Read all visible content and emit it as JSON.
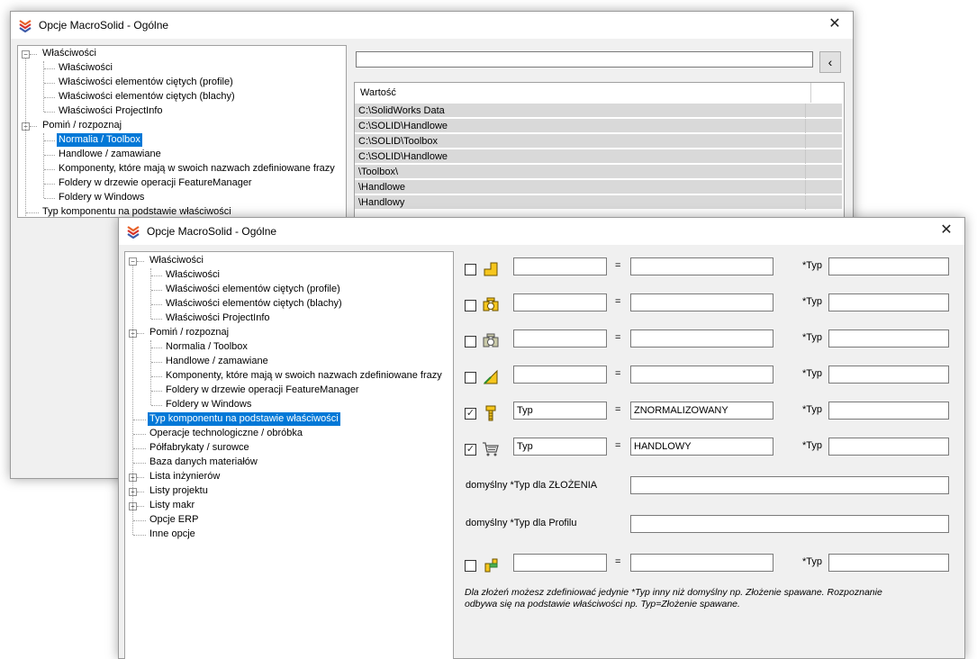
{
  "back_window": {
    "title": "Opcje MacroSolid - Ogólne",
    "close_label": "✕",
    "tree": [
      {
        "label": "Właściwości",
        "expander": "−"
      },
      {
        "label": "Właściwości"
      },
      {
        "label": "Właściwości elementów ciętych (profile)"
      },
      {
        "label": "Właściwości elementów ciętych (blachy)"
      },
      {
        "label": "Właściwości ProjectInfo"
      },
      {
        "label": "Pomiń / rozpoznaj",
        "expander": "−"
      },
      {
        "label": "Normalia / Toolbox"
      },
      {
        "label": "Handlowe / zamawiane"
      },
      {
        "label": "Komponenty, które mają w swoich nazwach zdefiniowane frazy"
      },
      {
        "label": "Foldery w drzewie operacji FeatureManager"
      },
      {
        "label": "Foldery w Windows"
      },
      {
        "label": "Typ komponentu na podstawie właściwości"
      },
      {
        "label": "Operacje technologiczne / obróbka"
      },
      {
        "label": "Półfabrykaty / surowce"
      },
      {
        "label": "Baza danych materiałów"
      },
      {
        "label": "Lista inżynierów",
        "expander": "+"
      },
      {
        "label": "Listy projektu",
        "expander": "+"
      },
      {
        "label": "Listy makr",
        "expander": "+"
      },
      {
        "label": "Opcje ERP"
      },
      {
        "label": "Inne opcje"
      }
    ],
    "search_value": "",
    "collapse_button": "‹",
    "grid": {
      "header": "Wartość",
      "rows": [
        "C:\\SolidWorks Data",
        "C:\\SOLID\\Handlowe",
        "C:\\SOLID\\Toolbox",
        "C:\\SOLID\\Handlowe",
        "\\Toolbox\\",
        "\\Handlowe",
        "\\Handlowy"
      ]
    }
  },
  "front_window": {
    "title": "Opcje MacroSolid - Ogólne",
    "close_label": "✕",
    "tree": [
      {
        "label": "Właściwości",
        "expander": "−"
      },
      {
        "label": "Właściwości"
      },
      {
        "label": "Właściwości elementów ciętych (profile)"
      },
      {
        "label": "Właściwości elementów ciętych (blachy)"
      },
      {
        "label": "Właściwości ProjectInfo"
      },
      {
        "label": "Pomiń / rozpoznaj",
        "expander": "−"
      },
      {
        "label": "Normalia / Toolbox"
      },
      {
        "label": "Handlowe / zamawiane"
      },
      {
        "label": "Komponenty, które mają w swoich nazwach zdefiniowane frazy"
      },
      {
        "label": "Foldery w drzewie operacji FeatureManager"
      },
      {
        "label": "Foldery w Windows"
      },
      {
        "label": "Typ komponentu na podstawie właściwości"
      },
      {
        "label": "Operacje technologiczne / obróbka"
      },
      {
        "label": "Półfabrykaty / surowce"
      },
      {
        "label": "Baza danych materiałów"
      },
      {
        "label": "Lista inżynierów",
        "expander": "+"
      },
      {
        "label": "Listy projektu",
        "expander": "+"
      },
      {
        "label": "Listy makr",
        "expander": "+"
      },
      {
        "label": "Opcje ERP"
      },
      {
        "label": "Inne opcje"
      }
    ],
    "rules": [
      {
        "checked": false,
        "icon": "part-icon",
        "property": "",
        "value": "",
        "type": ""
      },
      {
        "checked": false,
        "icon": "assembly-icon",
        "property": "",
        "value": "",
        "type": ""
      },
      {
        "checked": false,
        "icon": "assembly-gray-icon",
        "property": "",
        "value": "",
        "type": ""
      },
      {
        "checked": false,
        "icon": "weldment-icon",
        "property": "",
        "value": "",
        "type": ""
      },
      {
        "checked": true,
        "icon": "toolbox-icon",
        "property": "Typ",
        "value": "ZNORMALIZOWANY",
        "type": ""
      },
      {
        "checked": true,
        "icon": "cart-icon",
        "property": "Typ",
        "value": "HANDLOWY",
        "type": ""
      }
    ],
    "equals": "=",
    "type_label": "*Typ",
    "check_mark": "✓",
    "default_assembly_label": "domyślny *Typ dla ZŁOŻENIA",
    "default_assembly_value": "",
    "default_profile_label": "domyślny *Typ dla Profilu",
    "default_profile_value": "",
    "last_rule": {
      "checked": false,
      "icon": "sheet-icon",
      "property": "",
      "value": "",
      "type": ""
    },
    "note_line1": "Dla złożeń możesz zdefiniować jedynie *Typ inny niż domyślny np. Złożenie spawane. Rozpoznanie",
    "note_line2": "odbywa się na podstawie właściwości np. Typ=Złożenie spawane."
  }
}
